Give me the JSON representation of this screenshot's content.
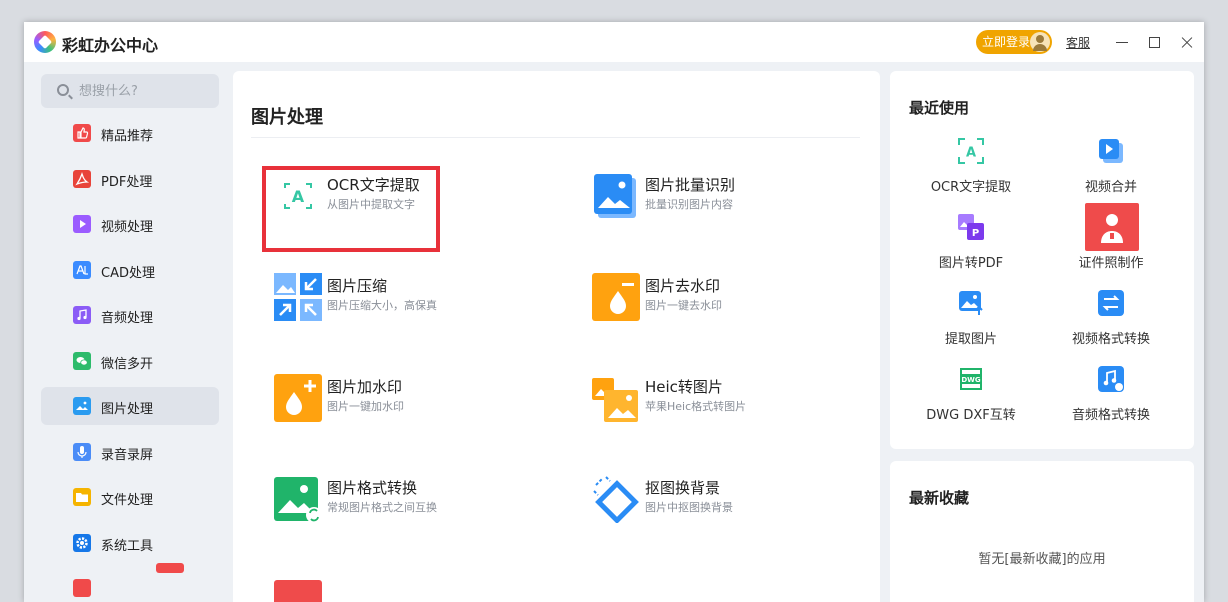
{
  "app": {
    "title": "彩虹办公中心",
    "login_label": "立即登录",
    "service_label": "客服"
  },
  "search": {
    "placeholder": "想搜什么?"
  },
  "sidebar": {
    "items": [
      {
        "label": "精品推荐",
        "icon": "thumbs-up-icon",
        "color": "#f04a4a"
      },
      {
        "label": "PDF处理",
        "icon": "pdf-icon",
        "color": "#e8443a"
      },
      {
        "label": "视频处理",
        "icon": "play-icon",
        "color": "#9b5cff"
      },
      {
        "label": "CAD处理",
        "icon": "cad-icon",
        "color": "#3a8bff"
      },
      {
        "label": "音频处理",
        "icon": "music-icon",
        "color": "#8b5cf6"
      },
      {
        "label": "微信多开",
        "icon": "wechat-icon",
        "color": "#2dbb6b"
      },
      {
        "label": "图片处理",
        "icon": "image-icon",
        "color": "#2a9bf0",
        "active": true
      },
      {
        "label": "录音录屏",
        "icon": "microphone-icon",
        "color": "#4a8cf7"
      },
      {
        "label": "文件处理",
        "icon": "folder-icon",
        "color": "#f5b400"
      },
      {
        "label": "系统工具",
        "icon": "gear-icon",
        "color": "#1677e8"
      }
    ]
  },
  "main": {
    "title": "图片处理",
    "tools": [
      {
        "name": "OCR文字提取",
        "desc": "从图片中提取文字",
        "icon": "ocr-icon"
      },
      {
        "name": "图片批量识别",
        "desc": "批量识别图片内容",
        "icon": "batch-image-icon"
      },
      {
        "name": "图片压缩",
        "desc": "图片压缩大小，高保真",
        "icon": "compress-icon"
      },
      {
        "name": "图片去水印",
        "desc": "图片一键去水印",
        "icon": "remove-watermark-icon"
      },
      {
        "name": "图片加水印",
        "desc": "图片一键加水印",
        "icon": "add-watermark-icon"
      },
      {
        "name": "Heic转图片",
        "desc": "苹果Heic格式转图片",
        "icon": "heic-icon"
      },
      {
        "name": "图片格式转换",
        "desc": "常规图片格式之间互换",
        "icon": "format-convert-icon"
      },
      {
        "name": "抠图换背景",
        "desc": "图片中抠图换背景",
        "icon": "cutout-icon"
      }
    ]
  },
  "recent": {
    "title": "最近使用",
    "items": [
      {
        "label": "OCR文字提取",
        "icon": "ocr-icon"
      },
      {
        "label": "视频合并",
        "icon": "video-merge-icon"
      },
      {
        "label": "图片转PDF",
        "icon": "image-to-pdf-icon"
      },
      {
        "label": "证件照制作",
        "icon": "id-photo-icon"
      },
      {
        "label": "提取图片",
        "icon": "extract-image-icon"
      },
      {
        "label": "视频格式转换",
        "icon": "video-convert-icon"
      },
      {
        "label": "DWG DXF互转",
        "icon": "dwg-icon"
      },
      {
        "label": "音频格式转换",
        "icon": "audio-convert-icon"
      }
    ]
  },
  "favorites": {
    "title": "最新收藏",
    "empty_text": "暂无[最新收藏]的应用"
  }
}
